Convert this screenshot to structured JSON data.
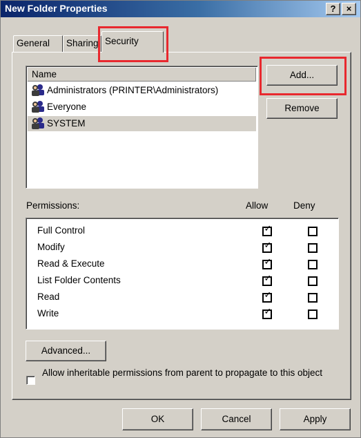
{
  "window": {
    "title": "New Folder Properties",
    "help_label": "?",
    "close_label": "×"
  },
  "tabs": [
    {
      "label": "General"
    },
    {
      "label": "Sharing"
    },
    {
      "label": "Security"
    }
  ],
  "names": {
    "header": "Name",
    "items": [
      {
        "label": "Administrators (PRINTER\\Administrators)",
        "icon": "user-group-icon"
      },
      {
        "label": "Everyone",
        "icon": "user-group-icon"
      },
      {
        "label": "SYSTEM",
        "icon": "user-group-icon",
        "selected": true
      }
    ]
  },
  "buttons": {
    "add": "Add...",
    "remove": "Remove",
    "advanced": "Advanced...",
    "ok": "OK",
    "cancel": "Cancel",
    "apply": "Apply"
  },
  "permissions": {
    "label": "Permissions:",
    "allow_header": "Allow",
    "deny_header": "Deny",
    "rows": [
      {
        "name": "Full Control",
        "allow": true,
        "deny": false
      },
      {
        "name": "Modify",
        "allow": true,
        "deny": false
      },
      {
        "name": "Read & Execute",
        "allow": true,
        "deny": false
      },
      {
        "name": "List Folder Contents",
        "allow": true,
        "deny": false
      },
      {
        "name": "Read",
        "allow": true,
        "deny": false
      },
      {
        "name": "Write",
        "allow": true,
        "deny": false
      }
    ]
  },
  "inherit": {
    "label": "Allow inheritable permissions from parent to propagate to this object",
    "checked": false
  },
  "colors": {
    "highlight": "#e8282e",
    "dialog_bg": "#d4d0c8",
    "title_start": "#0a246a"
  }
}
